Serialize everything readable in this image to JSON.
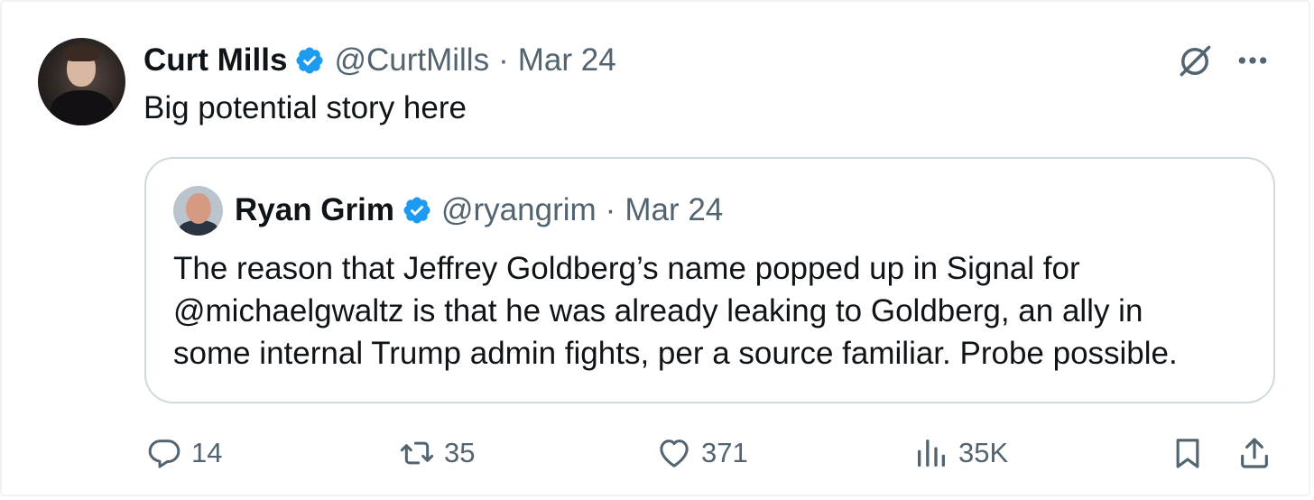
{
  "tweet": {
    "author_name": "Curt Mills",
    "author_handle": "@CurtMills",
    "separator": "·",
    "date": "Mar 24",
    "text": "Big potential story here"
  },
  "quoted_tweet": {
    "author_name": "Ryan Grim",
    "author_handle": "@ryangrim",
    "separator": "·",
    "date": "Mar 24",
    "text_lines": [
      "The reason that Jeffrey Goldberg’s name popped up in Signal for",
      "@michaelgwaltz is that he was already leaking to Goldberg, an ally in",
      "some internal Trump admin fights, per a source familiar. Probe possible."
    ]
  },
  "actions": {
    "replies": "14",
    "reposts": "35",
    "likes": "371",
    "views": "35K"
  },
  "icons": {
    "verified": "verified-badge-icon",
    "grok": "grok-icon",
    "more": "more-icon",
    "reply": "reply-icon",
    "repost": "repost-icon",
    "like": "heart-icon",
    "views": "views-icon",
    "bookmark": "bookmark-icon",
    "share": "share-icon"
  },
  "colors": {
    "text_primary": "#0f1419",
    "text_secondary": "#536471",
    "verified_blue": "#1d9bf0",
    "border": "#cfd9de"
  }
}
